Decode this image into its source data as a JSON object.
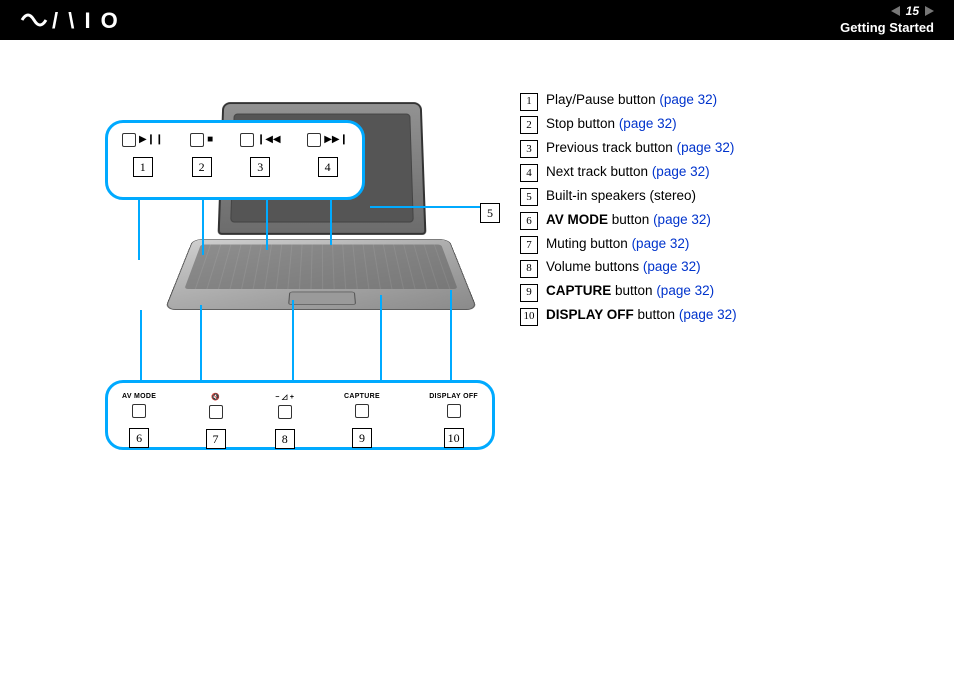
{
  "header": {
    "logo_text": "VAIO",
    "page_number": "15",
    "section": "Getting Started"
  },
  "diagram": {
    "top_panel": {
      "items": [
        {
          "num": "1",
          "icon": "▶❙❙",
          "aria": "play-pause-icon"
        },
        {
          "num": "2",
          "icon": "■",
          "aria": "stop-icon"
        },
        {
          "num": "3",
          "icon": "❙◀◀",
          "aria": "prev-track-icon"
        },
        {
          "num": "4",
          "icon": "▶▶❙",
          "aria": "next-track-icon"
        }
      ]
    },
    "side_callout": {
      "num": "5"
    },
    "bottom_panel": {
      "items": [
        {
          "num": "6",
          "label": "AV MODE",
          "icon": ""
        },
        {
          "num": "7",
          "label": "",
          "icon": "🔇"
        },
        {
          "num": "8",
          "label": "−   ◿   +",
          "icon": ""
        },
        {
          "num": "9",
          "label": "CAPTURE",
          "icon": ""
        },
        {
          "num": "10",
          "label": "DISPLAY OFF",
          "icon": ""
        }
      ]
    }
  },
  "legend": [
    {
      "num": "1",
      "bold": "",
      "text": "Play/Pause button ",
      "link": "(page 32)"
    },
    {
      "num": "2",
      "bold": "",
      "text": "Stop button ",
      "link": "(page 32)"
    },
    {
      "num": "3",
      "bold": "",
      "text": "Previous track button ",
      "link": "(page 32)"
    },
    {
      "num": "4",
      "bold": "",
      "text": "Next track button ",
      "link": "(page 32)"
    },
    {
      "num": "5",
      "bold": "",
      "text": "Built-in speakers (stereo)",
      "link": ""
    },
    {
      "num": "6",
      "bold": "AV MODE",
      "text": " button ",
      "link": "(page 32)"
    },
    {
      "num": "7",
      "bold": "",
      "text": "Muting button ",
      "link": "(page 32)"
    },
    {
      "num": "8",
      "bold": "",
      "text": "Volume buttons ",
      "link": "(page 32)"
    },
    {
      "num": "9",
      "bold": "CAPTURE",
      "text": " button ",
      "link": "(page 32)"
    },
    {
      "num": "10",
      "bold": "DISPLAY OFF",
      "text": " button ",
      "link": "(page 32)"
    }
  ]
}
